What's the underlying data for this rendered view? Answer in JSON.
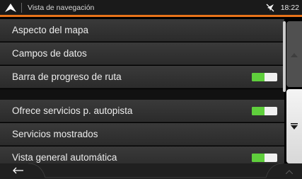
{
  "header": {
    "title": "Vista de navegación",
    "time": "18:22",
    "icons": [
      "navigation-arrow-icon",
      "gps-off-icon"
    ],
    "accent_color": "#e8731a"
  },
  "section1": [
    {
      "label": "Aspecto del mapa",
      "toggle": null
    },
    {
      "label": "Campos de datos",
      "toggle": null
    },
    {
      "label": "Barra de progreso de ruta",
      "toggle": true
    }
  ],
  "section2": [
    {
      "label": "Ofrece servicios p. autopista",
      "toggle": true
    },
    {
      "label": "Servicios mostrados",
      "toggle": null
    },
    {
      "label": "Vista general automática",
      "toggle": true
    }
  ],
  "toggle_on_color": "#5fcf3c",
  "footer": {
    "icons": [
      "back-arrow-icon",
      "chevron-up-icon"
    ]
  },
  "side": {
    "icons": [
      "scroll-up-icon",
      "scroll-down-icon"
    ]
  }
}
